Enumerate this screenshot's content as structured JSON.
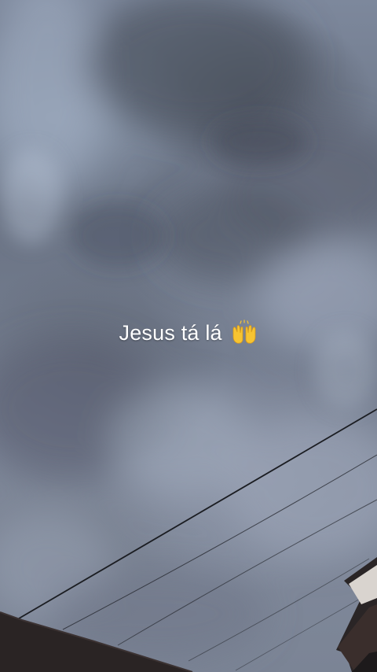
{
  "caption": {
    "text": "Jesus tá lá",
    "emoji": "raising-hands-emoji"
  },
  "colors": {
    "sky": "#737c8e",
    "cloud_dark": "#4b5260",
    "cloud_light": "#9aa6ba",
    "wires": "#1b1d22",
    "roof": "#2a2424",
    "caption_text": "#ffffff",
    "emoji_yellow": "#f7c431"
  }
}
